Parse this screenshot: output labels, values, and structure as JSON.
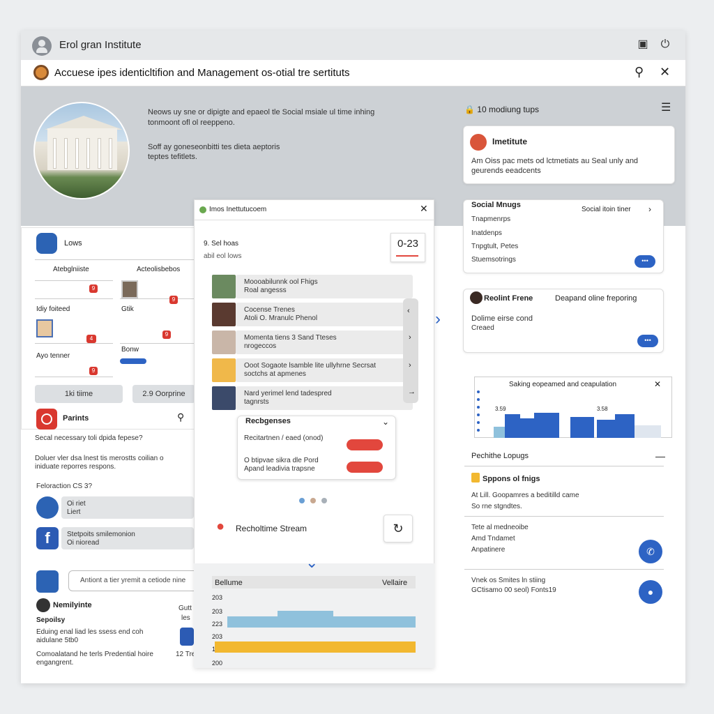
{
  "window": {
    "title": "Erol gran Institute"
  },
  "search": {
    "title": "Accuese ipes identicltifion and Management os-otial tre sertituts"
  },
  "hero": {
    "line1": "Neows uy sne or dipigte and epaeol tle Social msiale ul time inhing",
    "line2": "tonmoont ofl ol reeppeno.",
    "line3": "Soff ay goneseonbitti tes dieta aeptoris",
    "line4": "teptes tefitlets.",
    "status": "10 modiung tups"
  },
  "left": {
    "lows": "Lows",
    "col1": "Atebglniiste",
    "col2": "Acteolisbebos",
    "lbl1": "Idiy foiteed",
    "lbl2": "Gtik",
    "lbl3": "Ayo tenner",
    "lbl4": "Bonw",
    "btn1": "1ki tiime",
    "btn2": "2.9 Oorprine",
    "parints": "Parints",
    "q1": "Secal necessary toli dpida fepese?",
    "q2a": "Doluer vler dsa lnest tis merostts coilian o",
    "q2b": "iniduate reporres respons.",
    "feed": "Feloraction CS 3?",
    "c1a": "Oi riet",
    "c1b": "Liert",
    "c2a": "Stetpoits smilemonion",
    "c2b": "Oi nioread",
    "input": "Antiont a tier yremit a cetiode nine",
    "nm": "Nemilyinte",
    "sep": "Sepoilsy",
    "sep2a": "Eduing enal liad les ssess end coh",
    "sep2b": "aidulane 5tb0",
    "sep3a": "Comoalatand he terls Predential hoire",
    "sep3b": "engangrent.",
    "cut1": "Gutt",
    "cut2": "les",
    "cut3": "12 Tre"
  },
  "center": {
    "title": "Imos Inettutucoem",
    "sub1": "9. Sel hoas",
    "sub2": "abil eol lows",
    "counter": "0-23",
    "items": [
      {
        "a": "Moooabilunnk ool Fhigs",
        "b": "Roal angesss"
      },
      {
        "a": "Cocense Trenes",
        "b": "Atoli O. Mranulc Phenol"
      },
      {
        "a": "Momenta tiens 3 Sand Tteses",
        "b": "nrogeccos"
      },
      {
        "a": "Ooot Sogaote lsamble lite ullyhrne Secrsat",
        "b": "soctchs at apmenes"
      },
      {
        "a": "Nard yerimel lend tadespred",
        "b": "tagnrsts"
      }
    ],
    "recs": "Recbgenses",
    "rec1": "Recitartnen / eaed (onod)",
    "rec2a": "O btipvae sikra dle Pord",
    "rec2b": "Apand leadivia trapsne",
    "stream": "Recholtime Stream",
    "chartTitle": "Bellume",
    "chartRight": "Vellaire",
    "y1": "203",
    "y2": "203",
    "y3": "223",
    "y4": "203",
    "y5": "1",
    "y6": "200"
  },
  "right": {
    "institute": "Imetitute",
    "inst1": "Am Oiss pac mets od lctmetiats au Seal unly and",
    "inst2": "geurends eeadcents",
    "sm": "Social Mnugs",
    "smR": "Social itoin tiner",
    "sm1": "Tnapmenrps",
    "sm2": "Inatdenps",
    "sm3": "Tnpgtult, Petes",
    "sm4": "Stuemsotrings",
    "rf": "Reolint Frene",
    "rfR": "Deapand oline freporing",
    "rf1": "Dolime eirse cond",
    "rf2": "Creaed",
    "chartT": "Saking eopeamed and ceapulation",
    "cl1": "3.59",
    "cl2": "3.58",
    "lookups": "Pechithe Lopugs",
    "spons": "Sppons ol fnigs",
    "sp1": "At Lill. Goopamres a beditilld came",
    "sp2": "So rne stgndtes.",
    "t1": "Tete al medneoibe",
    "t2": "Amd Tndamet",
    "t3": "Anpatinere",
    "v1": "Vnek os Smites ln stiing",
    "v2": "GCtisamo 00 seol) Fonts19"
  },
  "colors": {
    "accent": "#2d63c4",
    "red": "#e2473d",
    "barBlue": "#2d63c4",
    "barLight": "#8fc1dc",
    "barYellow": "#f2b830"
  }
}
